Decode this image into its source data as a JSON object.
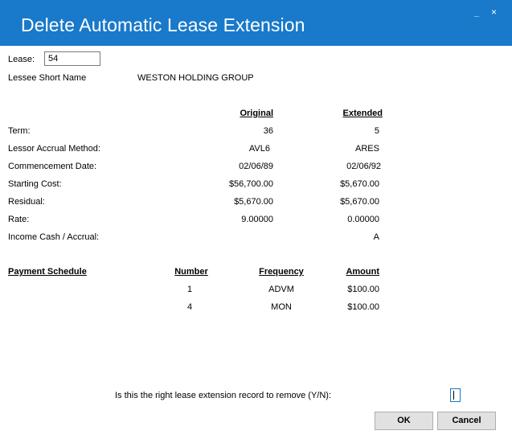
{
  "window": {
    "title": "Delete Automatic Lease Extension",
    "minimize_glyph": "_",
    "close_glyph": "×"
  },
  "lease": {
    "label": "Lease:",
    "value": "54"
  },
  "lessee": {
    "label": "Lessee Short Name",
    "value": "WESTON HOLDING GROUP"
  },
  "details": {
    "headers": {
      "original": "Original",
      "extended": "Extended"
    },
    "rows": [
      {
        "label": "Term:",
        "original": "36",
        "extended": "5"
      },
      {
        "label": "Lessor Accrual Method:",
        "original": "AVL6",
        "extended": "ARES"
      },
      {
        "label": "Commencement Date:",
        "original": "02/06/89",
        "extended": "02/06/92"
      },
      {
        "label": "Starting Cost:",
        "original": "$56,700.00",
        "extended": "$5,670.00"
      },
      {
        "label": "Residual:",
        "original": "$5,670.00",
        "extended": "$5,670.00"
      },
      {
        "label": "Rate:",
        "original": "9.00000",
        "extended": "0.00000"
      },
      {
        "label": "Income Cash / Accrual:",
        "original": "",
        "extended": "A"
      }
    ]
  },
  "schedule": {
    "title": "Payment Schedule",
    "headers": {
      "number": "Number",
      "frequency": "Frequency",
      "amount": "Amount"
    },
    "rows": [
      {
        "number": "1",
        "frequency": "ADVM",
        "amount": "$100.00"
      },
      {
        "number": "4",
        "frequency": "MON",
        "amount": "$100.00"
      }
    ]
  },
  "confirm": {
    "prompt": "Is this the right lease extension record to remove (Y/N):",
    "value": ""
  },
  "buttons": {
    "ok": "OK",
    "cancel": "Cancel"
  },
  "colors": {
    "titlebar": "#1979ca",
    "background": "#ffffff",
    "button": "#e1e1e1"
  }
}
